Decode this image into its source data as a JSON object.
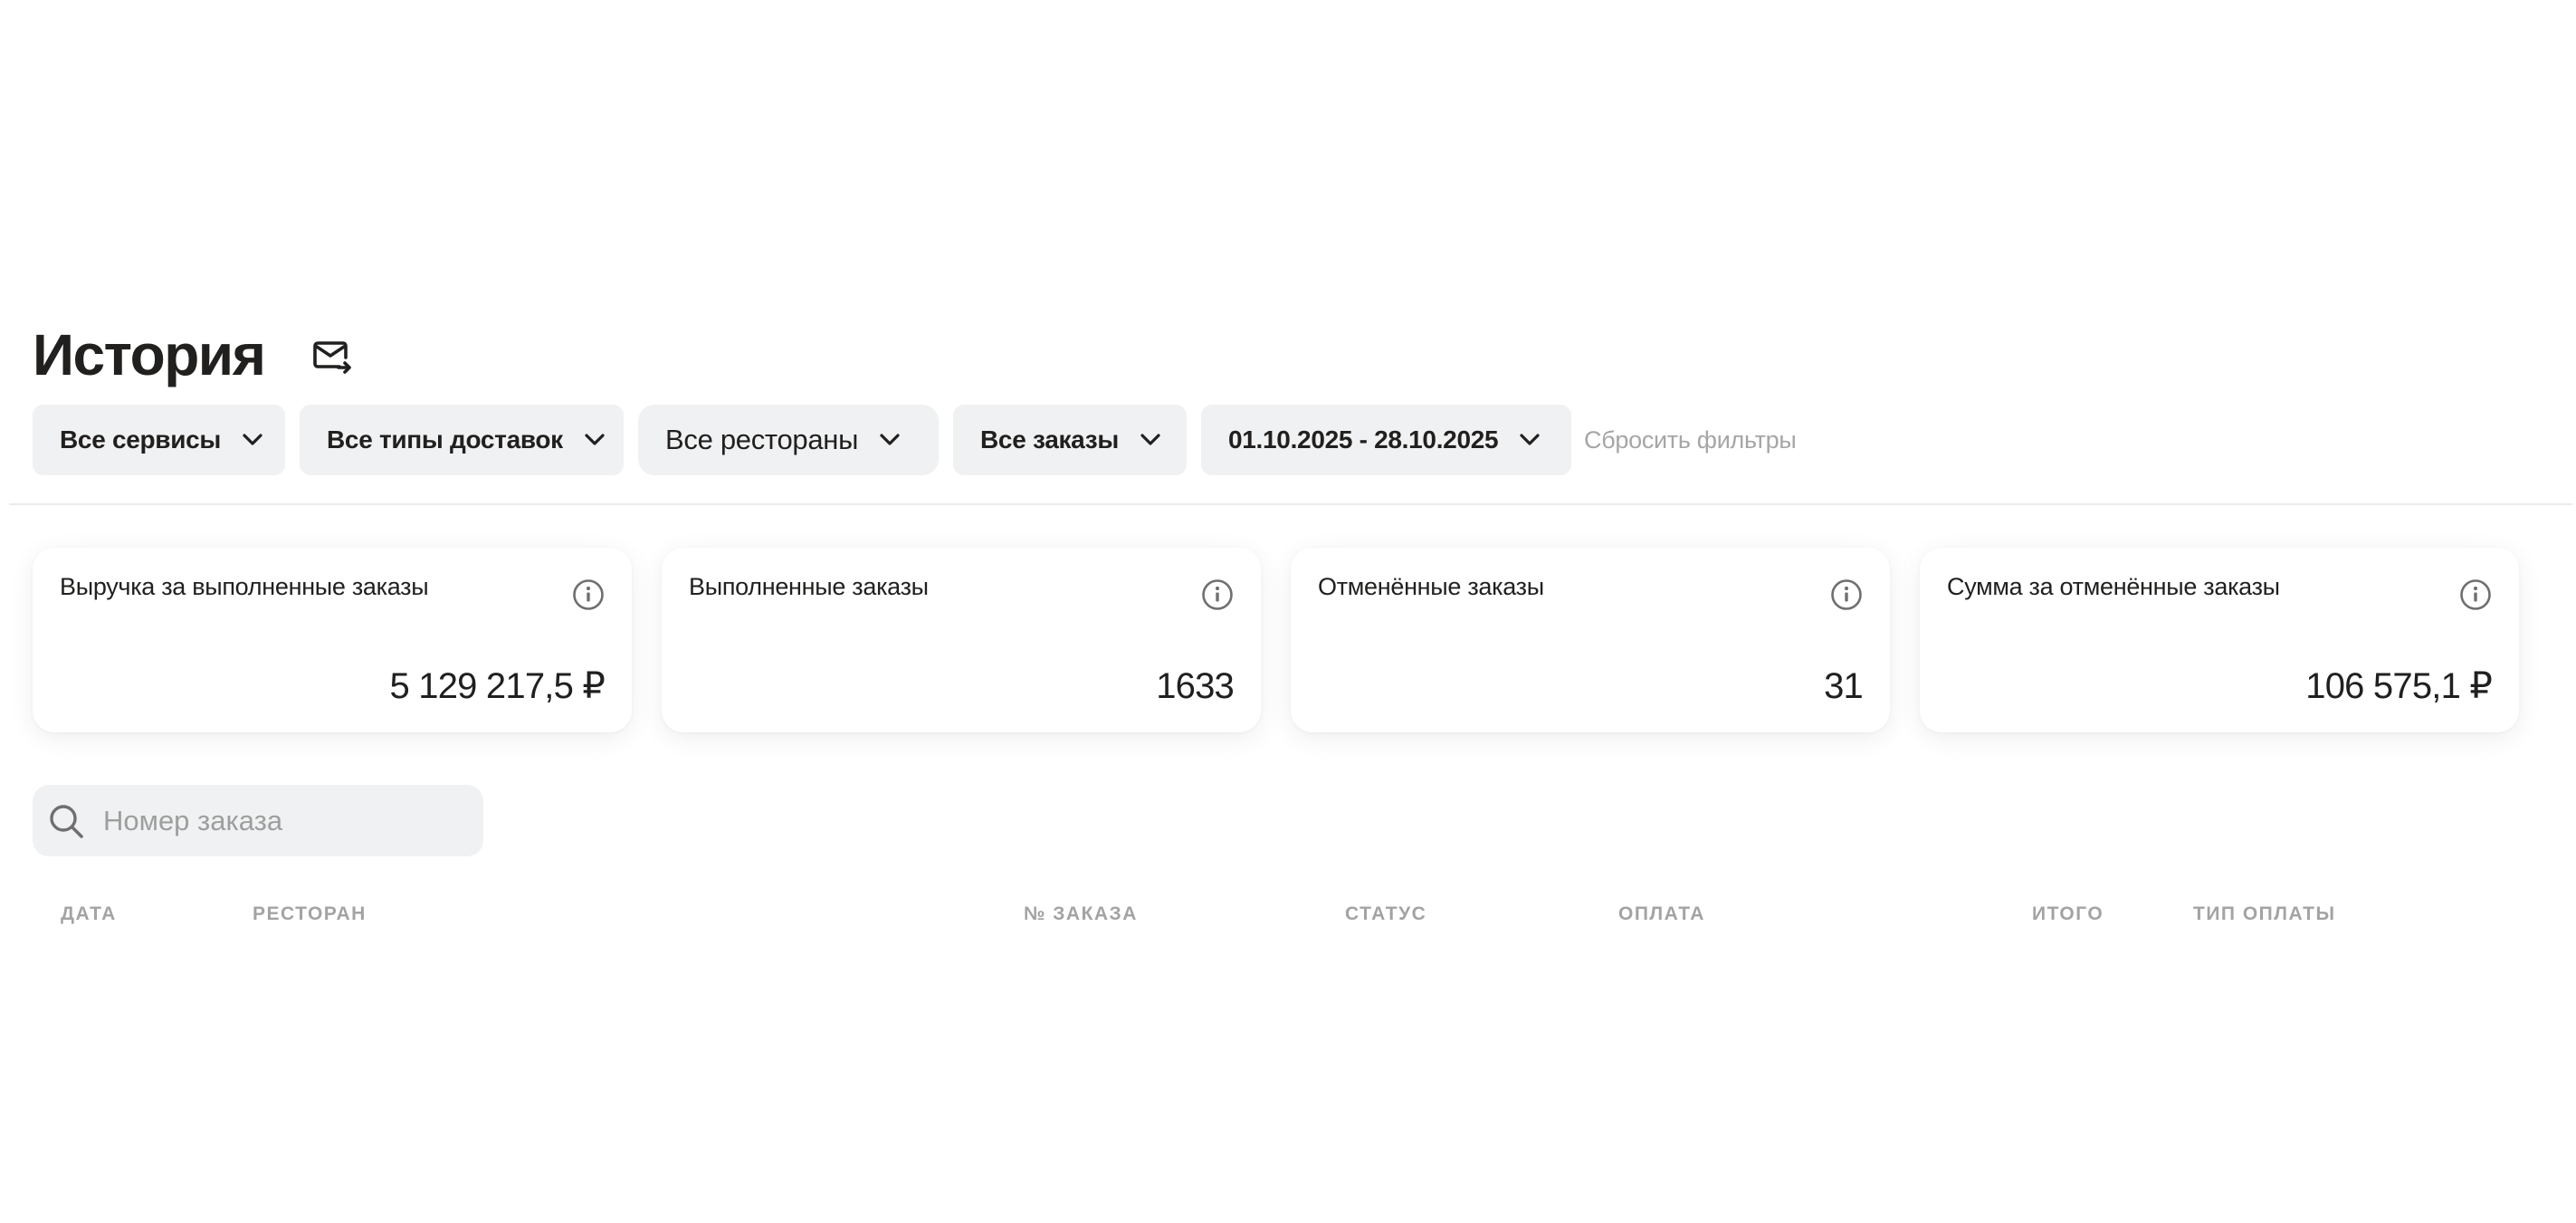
{
  "header": {
    "title": "История",
    "export_icon": "mail-export-icon"
  },
  "filters": [
    {
      "label": "Все сервисы",
      "icon": "chevron-down-icon"
    },
    {
      "label": "Все типы доставок",
      "icon": "chevron-down-icon"
    },
    {
      "label": "Все рестораны",
      "icon": "chevron-down-icon"
    },
    {
      "label": "Все заказы",
      "icon": "chevron-down-icon"
    },
    {
      "label": "01.10.2025 - 28.10.2025",
      "icon": "chevron-down-icon"
    }
  ],
  "reset_filters": "Сбросить фильтры",
  "stats": [
    {
      "title": "Выручка за выполненные заказы",
      "value": "5 129 217,5 ₽",
      "icon": "info-icon"
    },
    {
      "title": "Выполненные заказы",
      "value": "1633",
      "icon": "info-icon"
    },
    {
      "title": "Отменённые заказы",
      "value": "31",
      "icon": "info-icon"
    },
    {
      "title": "Сумма за отменённые заказы",
      "value": "106 575,1 ₽",
      "icon": "info-icon"
    }
  ],
  "search": {
    "placeholder": "Номер заказа",
    "value": "",
    "icon": "search-icon"
  },
  "table": {
    "columns": [
      "Дата",
      "Ресторан",
      "№ заказа",
      "Статус",
      "Оплата",
      "Итого",
      "Тип оплаты"
    ],
    "rows": []
  },
  "colors": {
    "text": "#21201f",
    "muted": "#a3a3a3",
    "chip_bg": "#f0f1f2",
    "background": "#ffffff"
  }
}
